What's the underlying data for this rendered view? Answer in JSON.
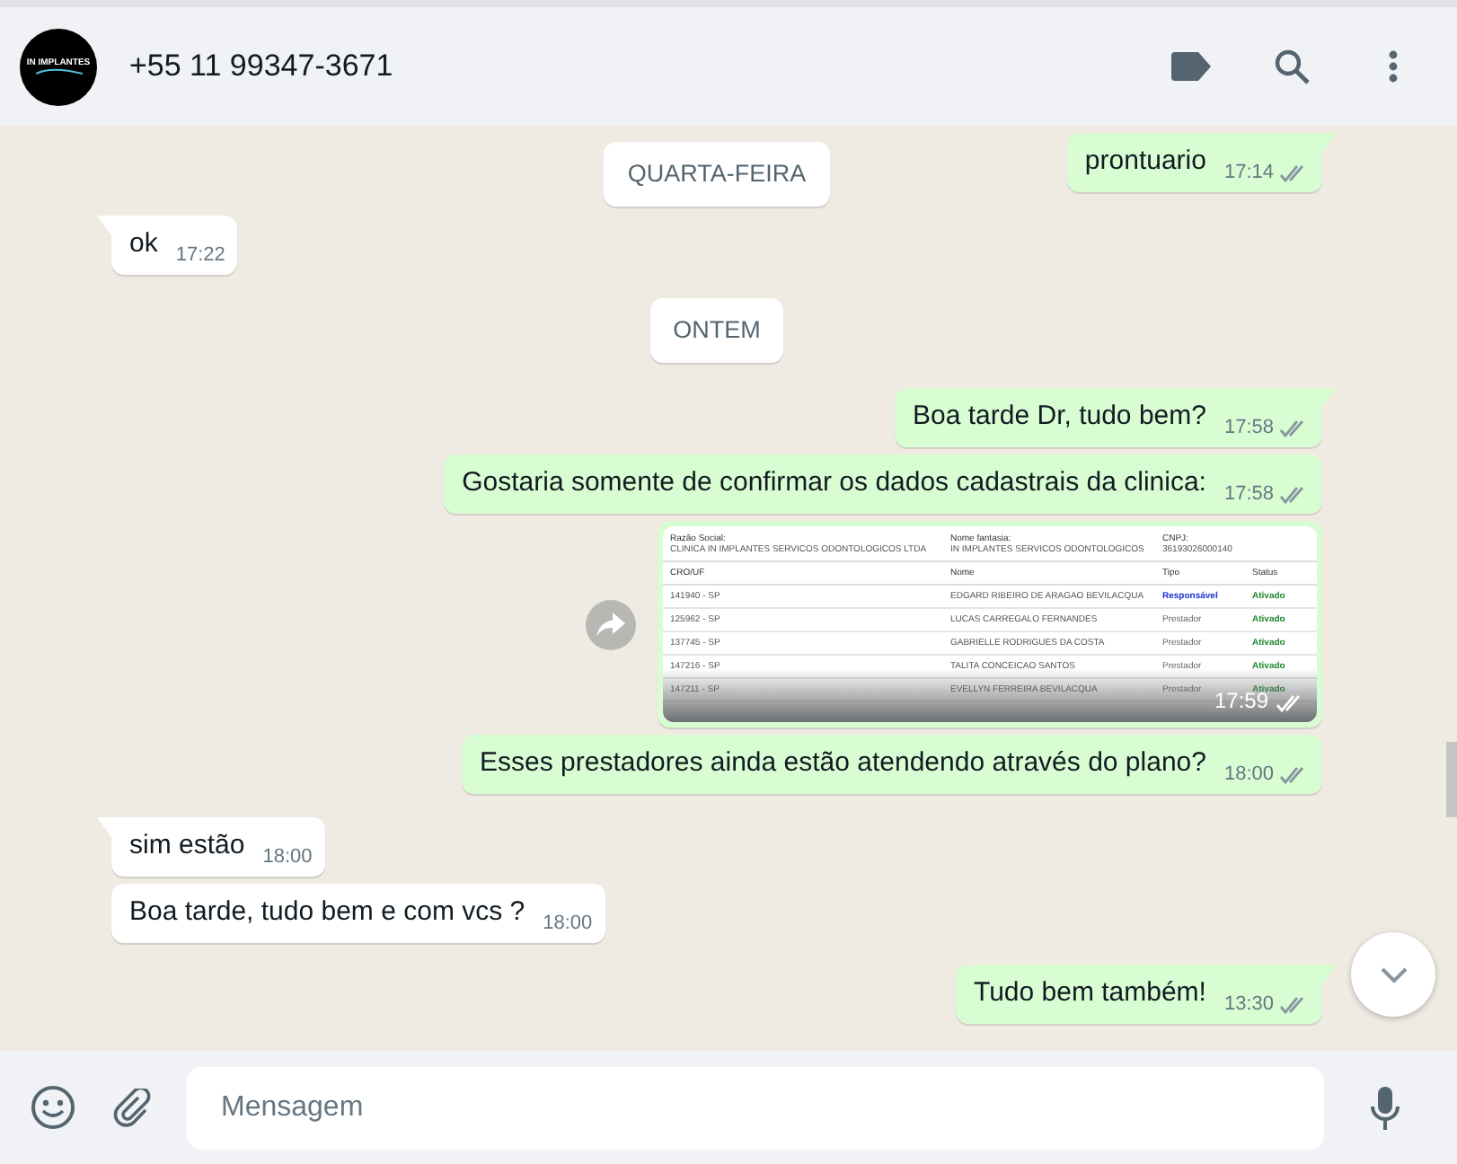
{
  "header": {
    "avatar_logo": "IN IMPLANTES",
    "title": "+55 11 99347-3671"
  },
  "sticky_date": "QUARTA-FEIRA",
  "messages": [
    {
      "kind": "outgoing_text",
      "text": "prontuario",
      "time": "17:14"
    },
    {
      "kind": "incoming_text",
      "text": "ok",
      "time": "17:22"
    },
    {
      "kind": "date",
      "text": "ONTEM"
    },
    {
      "kind": "outgoing_text",
      "text": "Boa tarde Dr, tudo bem?",
      "time": "17:58"
    },
    {
      "kind": "outgoing_text",
      "text": "Gostaria somente de confirmar os dados cadastrais da clinica:",
      "time": "17:58"
    },
    {
      "kind": "outgoing_image",
      "time": "17:59",
      "document": {
        "info": [
          {
            "label": "Razão Social:",
            "value": "CLINICA IN IMPLANTES SERVICOS ODONTOLOGICOS LTDA"
          },
          {
            "label": "Nome fantasia:",
            "value": "IN IMPLANTES SERVICOS ODONTOLOGICOS"
          },
          {
            "label": "CNPJ:",
            "value": "36193026000140"
          }
        ],
        "columns": [
          "CRO/UF",
          "Nome",
          "Tipo",
          "Status"
        ],
        "rows": [
          {
            "cro": "141940 - SP",
            "name": "EDGARD RIBEIRO DE ARAGAO BEVILACQUA",
            "type": "Responsável",
            "kind": "responsible",
            "status": "Ativado"
          },
          {
            "cro": "125962 - SP",
            "name": "LUCAS CARREGALO FERNANDES",
            "type": "Prestador",
            "kind": "provider",
            "status": "Ativado"
          },
          {
            "cro": "137745 - SP",
            "name": "GABRIELLE RODRIGUES DA COSTA",
            "type": "Prestador",
            "kind": "provider",
            "status": "Ativado"
          },
          {
            "cro": "147216 - SP",
            "name": "TALITA CONCEICAO SANTOS",
            "type": "Prestador",
            "kind": "provider",
            "status": "Ativado"
          },
          {
            "cro": "147211 - SP",
            "name": "EVELLYN FERREIRA BEVILACQUA",
            "type": "Prestador",
            "kind": "provider",
            "status": "Ativado"
          }
        ]
      }
    },
    {
      "kind": "outgoing_text",
      "text": "Esses prestadores ainda estão atendendo através do plano?",
      "time": "18:00"
    },
    {
      "kind": "incoming_text",
      "text": "sim estão",
      "time": "18:00"
    },
    {
      "kind": "incoming_text",
      "text": "Boa tarde, tudo bem e com vcs ?",
      "time": "18:00"
    },
    {
      "kind": "outgoing_text",
      "text": "Tudo bem também!",
      "time": "13:30"
    }
  ],
  "composer": {
    "placeholder": "Mensagem"
  }
}
